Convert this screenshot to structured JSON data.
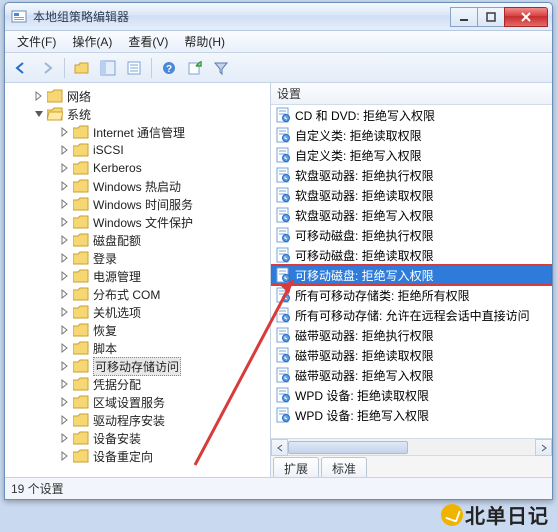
{
  "window": {
    "title": "本地组策略编辑器"
  },
  "menu": {
    "file": "文件(F)",
    "action": "操作(A)",
    "view": "查看(V)",
    "help": "帮助(H)"
  },
  "tree": {
    "network": "网络",
    "system": "系统",
    "children": [
      "Internet 通信管理",
      "iSCSI",
      "Kerberos",
      "Windows 热启动",
      "Windows 时间服务",
      "Windows 文件保护",
      "磁盘配额",
      "登录",
      "电源管理",
      "分布式 COM",
      "关机选项",
      "恢复",
      "脚本",
      "可移动存储访问",
      "凭据分配",
      "区域设置服务",
      "驱动程序安装",
      "设备安装",
      "设备重定向"
    ],
    "selectedIndex": 13
  },
  "list": {
    "header": "设置",
    "items": [
      "CD 和 DVD: 拒绝写入权限",
      "自定义类: 拒绝读取权限",
      "自定义类: 拒绝写入权限",
      "软盘驱动器: 拒绝执行权限",
      "软盘驱动器: 拒绝读取权限",
      "软盘驱动器: 拒绝写入权限",
      "可移动磁盘: 拒绝执行权限",
      "可移动磁盘: 拒绝读取权限",
      "可移动磁盘: 拒绝写入权限",
      "所有可移动存储类: 拒绝所有权限",
      "所有可移动存储: 允许在远程会话中直接访问",
      "磁带驱动器: 拒绝执行权限",
      "磁带驱动器: 拒绝读取权限",
      "磁带驱动器: 拒绝写入权限",
      "WPD 设备: 拒绝读取权限",
      "WPD 设备: 拒绝写入权限"
    ],
    "selectedIndex": 8
  },
  "tabs": {
    "ext": "扩展",
    "std": "标准"
  },
  "status": "19 个设置",
  "watermark": "北单日记"
}
